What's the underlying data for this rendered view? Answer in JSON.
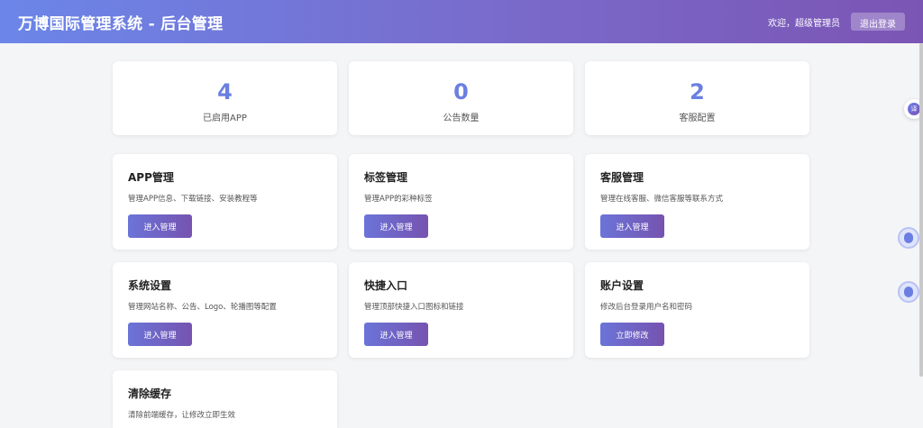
{
  "header": {
    "title": "万博国际管理系统 - 后台管理",
    "welcome": "欢迎，超级管理员",
    "logout_label": "退出登录"
  },
  "stats": [
    {
      "value": "4",
      "label": "已启用APP"
    },
    {
      "value": "0",
      "label": "公告数量"
    },
    {
      "value": "2",
      "label": "客服配置"
    }
  ],
  "menus": [
    {
      "title": "APP管理",
      "desc": "管理APP信息、下载链接、安装教程等",
      "button": "进入管理"
    },
    {
      "title": "标签管理",
      "desc": "管理APP的彩种标签",
      "button": "进入管理"
    },
    {
      "title": "客服管理",
      "desc": "管理在线客服、微信客服等联系方式",
      "button": "进入管理"
    },
    {
      "title": "系统设置",
      "desc": "管理网站名称、公告、Logo、轮播图等配置",
      "button": "进入管理"
    },
    {
      "title": "快捷入口",
      "desc": "管理顶部快捷入口图标和链接",
      "button": "进入管理"
    },
    {
      "title": "账户设置",
      "desc": "修改后台登录用户名和密码",
      "button": "立即修改"
    },
    {
      "title": "清除缓存",
      "desc": "清除前端缓存，让修改立即生效",
      "button": ""
    }
  ],
  "floating": {
    "translate_label": "译"
  },
  "colors": {
    "accent": "#6a7fe0",
    "header_start": "#6b86e8",
    "header_end": "#7b55b4"
  }
}
